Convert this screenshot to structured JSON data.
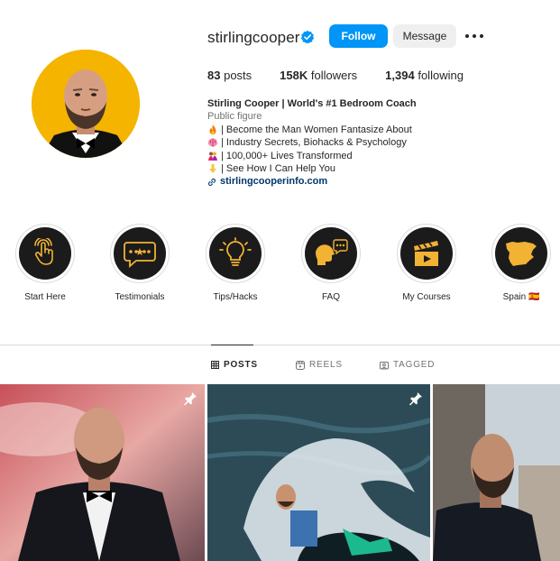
{
  "profile": {
    "username": "stirlingcooper",
    "verified": true,
    "follow_label": "Follow",
    "message_label": "Message",
    "stats": {
      "posts_count": "83",
      "posts_label": "posts",
      "followers_count": "158K",
      "followers_label": "followers",
      "following_count": "1,394",
      "following_label": "following"
    },
    "bio": {
      "name": "Stirling Cooper | World's #1 Bedroom Coach",
      "category": "Public figure",
      "lines": [
        {
          "icon": "fire-icon",
          "text": "| Become the Man Women Fantasize About"
        },
        {
          "icon": "brain-icon",
          "text": "| Industry Secrets, Biohacks & Psychology"
        },
        {
          "icon": "couple-icon",
          "text": "| 100,000+ Lives Transformed"
        },
        {
          "icon": "pointing-down-icon",
          "text": "| See How I Can Help You"
        }
      ],
      "link": "stirlingcooperinfo.com"
    }
  },
  "highlights": [
    {
      "label": "Start Here",
      "icon": "touch-hand-icon"
    },
    {
      "label": "Testimonials",
      "icon": "rating-bubble-icon"
    },
    {
      "label": "Tips/Hacks",
      "icon": "lightbulb-icon"
    },
    {
      "label": "FAQ",
      "icon": "chat-head-icon"
    },
    {
      "label": "My Courses",
      "icon": "film-clapper-icon"
    },
    {
      "label": "Spain 🇪🇸",
      "icon": "spain-map-icon"
    }
  ],
  "tabs": [
    {
      "label": "POSTS",
      "icon": "grid-icon",
      "active": true
    },
    {
      "label": "REELS",
      "icon": "reels-icon",
      "active": false
    },
    {
      "label": "TAGGED",
      "icon": "tagged-icon",
      "active": false
    }
  ],
  "posts": [
    {
      "pinned": true
    },
    {
      "pinned": true
    },
    {
      "pinned": false
    }
  ],
  "colors": {
    "accent": "#0095f6",
    "highlight_icon": "#f2b233",
    "avatar_bg": "#f4b400"
  }
}
